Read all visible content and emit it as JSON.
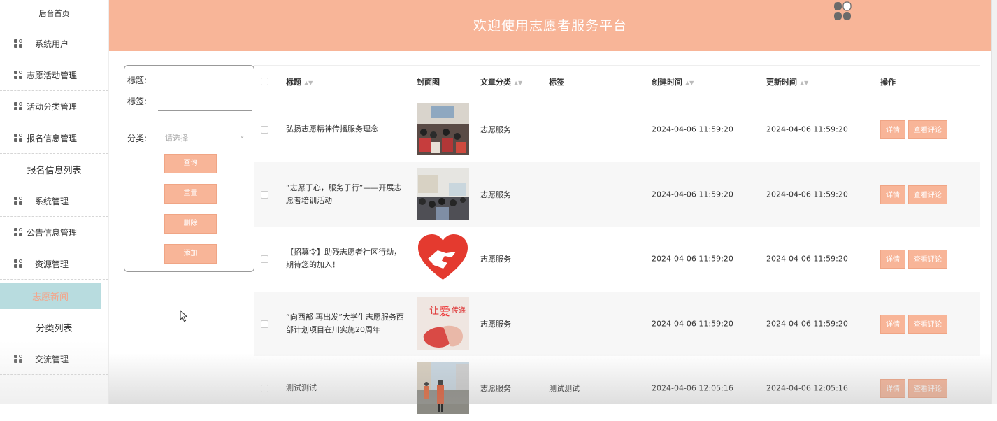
{
  "header": {
    "title": "欢迎使用志愿者服务平台"
  },
  "sidebar": {
    "home": "后台首页",
    "items": [
      {
        "label": "系统用户",
        "type": "menu",
        "wide": true
      },
      {
        "label": "志愿活动管理",
        "type": "menu",
        "wide": false
      },
      {
        "label": "活动分类管理",
        "type": "menu",
        "wide": false
      },
      {
        "label": "报名信息管理",
        "type": "menu",
        "wide": false
      },
      {
        "label": "报名信息列表",
        "type": "sub"
      },
      {
        "label": "系统管理",
        "type": "menu",
        "wide": true
      },
      {
        "label": "公告信息管理",
        "type": "menu",
        "wide": false
      },
      {
        "label": "资源管理",
        "type": "menu",
        "wide": true
      },
      {
        "label": "志愿新闻",
        "type": "sub-active"
      },
      {
        "label": "分类列表",
        "type": "sub"
      },
      {
        "label": "交流管理",
        "type": "menu",
        "wide": true
      }
    ]
  },
  "search": {
    "title_label": "标题:",
    "tag_label": "标签:",
    "category_label": "分类:",
    "category_placeholder": "请选择",
    "query_button": "查询",
    "reset_button": "重置",
    "delete_button": "删除",
    "add_button": "添加"
  },
  "table": {
    "headers": {
      "title": "标题",
      "cover": "封面图",
      "category": "文章分类",
      "tag": "标签",
      "created": "创建时间",
      "updated": "更新时间",
      "actions": "操作"
    },
    "detail_button": "详情",
    "comments_button": "查看评论",
    "rows": [
      {
        "title": "弘扬志愿精神传播服务理念",
        "category": "志愿服务",
        "tag": "",
        "created": "2024-04-06 11:59:20",
        "updated": "2024-04-06 11:59:20",
        "image": "classroom"
      },
      {
        "title": "“志愿于心，服务于行”——开展志愿者培训活动",
        "category": "志愿服务",
        "tag": "",
        "created": "2024-04-06 11:59:20",
        "updated": "2024-04-06 11:59:20",
        "image": "meeting"
      },
      {
        "title": "【招募令】助残志愿者社区行动，期待您的加入！",
        "category": "志愿服务",
        "tag": "",
        "created": "2024-04-06 11:59:20",
        "updated": "2024-04-06 11:59:20",
        "image": "heart"
      },
      {
        "title": "“向西部 再出发”大学生志愿服务西部计划项目在川实施20周年",
        "category": "志愿服务",
        "tag": "",
        "created": "2024-04-06 11:59:20",
        "updated": "2024-04-06 11:59:20",
        "image": "love"
      },
      {
        "title": "测试测试",
        "category": "志愿服务",
        "tag": "测试测试",
        "created": "2024-04-06 12:05:16",
        "updated": "2024-04-06 12:05:16",
        "image": "street"
      }
    ]
  },
  "icons": {
    "sidebar_menu": "grid-icon",
    "sort": "sort-icon",
    "logo": "logo-icon",
    "cursor": "mouse-cursor-icon"
  },
  "colors": {
    "accent": "#f8b598",
    "active_bg": "#b8dcdf",
    "active_text": "#f4a58a"
  }
}
